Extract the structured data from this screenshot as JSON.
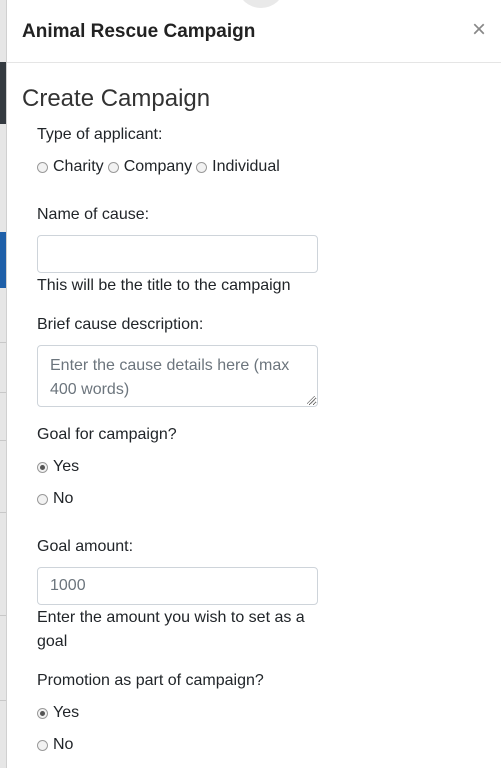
{
  "modal": {
    "title": "Animal Rescue Campaign",
    "close_label": "×",
    "section_title": "Create Campaign"
  },
  "form": {
    "applicant": {
      "label": "Type of applicant:",
      "options": [
        "Charity",
        "Company",
        "Individual"
      ],
      "selected": null
    },
    "cause_name": {
      "label": "Name of cause:",
      "value": "",
      "help": "This will be the title to the campaign"
    },
    "description": {
      "label": "Brief cause description:",
      "placeholder": "Enter the cause details here (max 400 words)"
    },
    "goal": {
      "label": "Goal for campaign?",
      "options": [
        "Yes",
        "No"
      ],
      "selected": "Yes"
    },
    "goal_amount": {
      "label": "Goal amount:",
      "placeholder": "1000",
      "help": "Enter the amount you wish to set as a goal"
    },
    "promotion": {
      "label": "Promotion as part of campaign?",
      "options": [
        "Yes",
        "No"
      ],
      "selected": "Yes"
    }
  },
  "colors": {
    "modal_bg": "#ffffff",
    "text": "#212529",
    "border": "#ced4da",
    "backdrop": "#e6e6e6"
  }
}
